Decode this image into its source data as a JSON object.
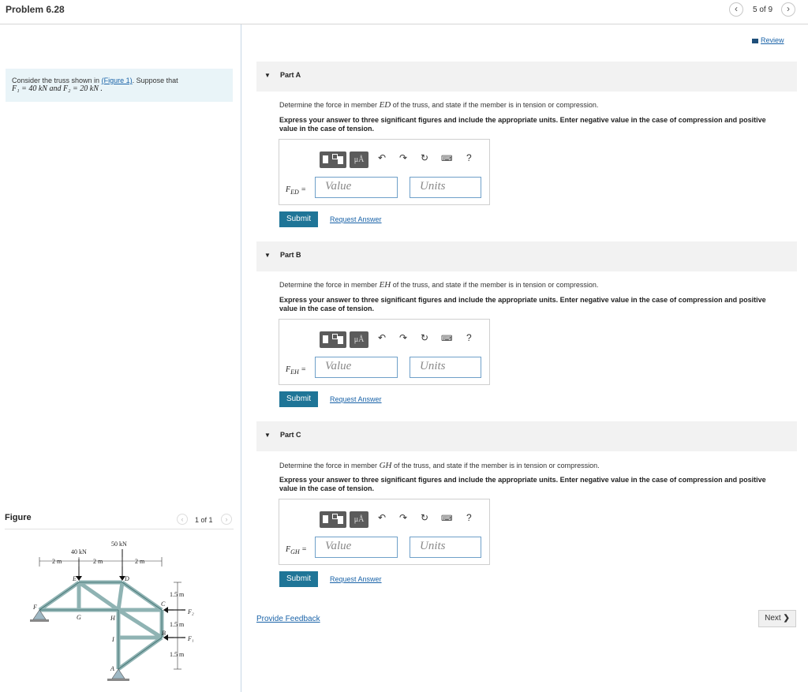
{
  "header": {
    "problem_title": "Problem 6.28",
    "page_count": "5 of 9",
    "prev_icon": "chevron-left-icon",
    "next_icon": "chevron-right-icon"
  },
  "problem": {
    "intro": "Consider the truss shown in",
    "figure_link": "(Figure 1)",
    "intro_end": ". Suppose that",
    "given": "F₁ = 40 kN and F₂ = 20 kN ."
  },
  "figure": {
    "label": "Figure",
    "count": "1 of 1",
    "truss_labels": {
      "load_e": "40 kN",
      "load_d": "50 kN",
      "dim1": "2 m",
      "dim2": "2 m",
      "dim3": "2 m",
      "dim_v1": "1.5 m",
      "dim_v2": "1.5 m",
      "dim_v3": "1.5 m",
      "f2": "F₂",
      "f1": "F₁",
      "E": "E",
      "D": "D",
      "F": "F",
      "G": "G",
      "H": "H",
      "C": "C",
      "B": "B",
      "I": "I",
      "A": "A"
    }
  },
  "review": "Review",
  "parts": [
    {
      "title": "Part A",
      "q1_pre": "Determine the force in member",
      "member": "ED",
      "q1_post": "of the truss, and state if the member is in tension or compression.",
      "q2": "Express your answer to three significant figures and include the appropriate units. Enter negative value in the case of compression and positive value in the case of tension.",
      "var": "F",
      "sub": "ED",
      "eq": "=",
      "value_placeholder": "Value",
      "units_placeholder": "Units",
      "submit": "Submit",
      "request": "Request Answer"
    },
    {
      "title": "Part B",
      "q1_pre": "Determine the force in member",
      "member": "EH",
      "q1_post": "of the truss, and state if the member is in tension or compression.",
      "q2": "Express your answer to three significant figures and include the appropriate units. Enter negative value in the case of compression and positive value in the case of tension.",
      "var": "F",
      "sub": "EH",
      "eq": "=",
      "value_placeholder": "Value",
      "units_placeholder": "Units",
      "submit": "Submit",
      "request": "Request Answer"
    },
    {
      "title": "Part C",
      "q1_pre": "Determine the force in member",
      "member": "GH",
      "q1_post": "of the truss, and state if the member is in tension or compression.",
      "q2": "Express your answer to three significant figures and include the appropriate units. Enter negative value in the case of compression and positive value in the case of tension.",
      "var": "F",
      "sub": "GH",
      "eq": "=",
      "value_placeholder": "Value",
      "units_placeholder": "Units",
      "submit": "Submit",
      "request": "Request Answer"
    }
  ],
  "toolbar": {
    "mu_label": "μÅ",
    "help": "?"
  },
  "footer": {
    "feedback": "Provide Feedback",
    "next": "Next"
  },
  "colors": {
    "accent": "#1f7597",
    "link": "#1a63a8",
    "problem_bg": "#e9f4f8"
  }
}
